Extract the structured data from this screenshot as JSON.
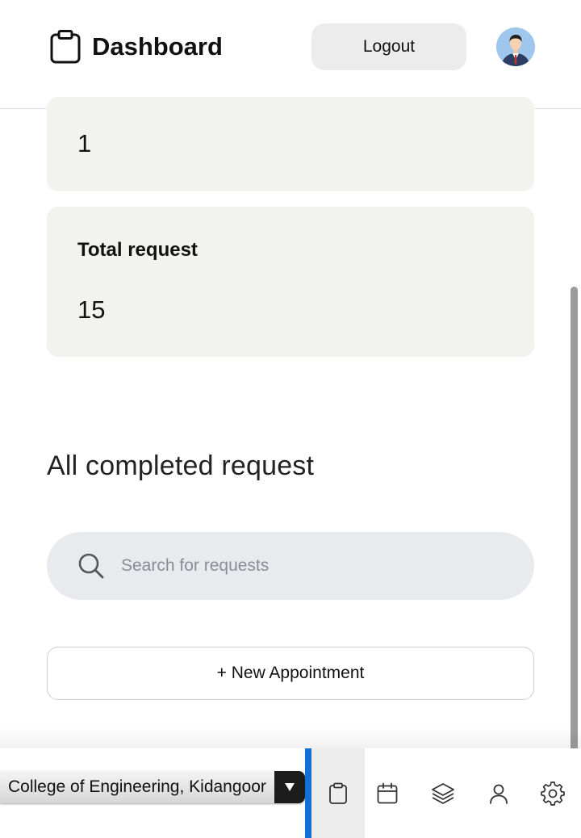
{
  "header": {
    "title": "Dashboard",
    "logout_label": "Logout"
  },
  "stats": {
    "top_card_value": "1",
    "total_label": "Total request",
    "total_value": "15"
  },
  "section": {
    "title": "All completed request"
  },
  "search": {
    "placeholder": "Search for requests"
  },
  "actions": {
    "new_appointment_label": "+ New Appointment"
  },
  "footer": {
    "college_selected": "College of Engineering, Kidangoor",
    "nav": [
      {
        "icon": "clipboard-icon",
        "active": true
      },
      {
        "icon": "calendar-icon",
        "active": false
      },
      {
        "icon": "layers-icon",
        "active": false
      },
      {
        "icon": "user-icon",
        "active": false
      },
      {
        "icon": "settings-icon",
        "active": false
      }
    ]
  },
  "colors": {
    "accent": "#1371d6",
    "card_bg": "#f2f2ef",
    "search_bg": "#e9eaed"
  }
}
